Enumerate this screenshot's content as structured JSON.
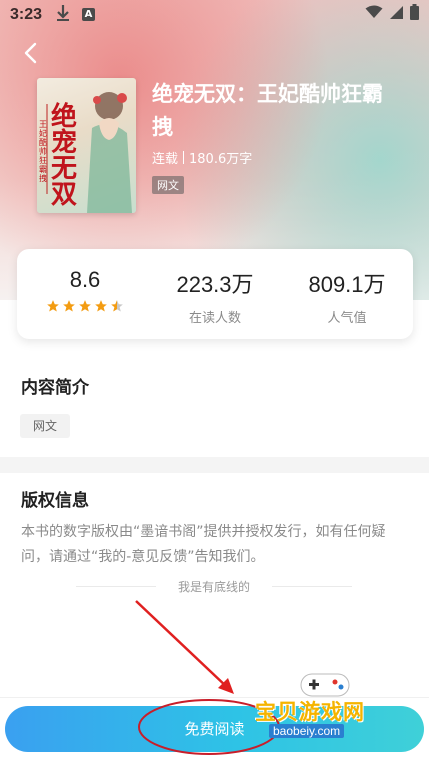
{
  "status_bar": {
    "time": "3:23",
    "left_icons": [
      "download-icon",
      "a-notification-icon"
    ],
    "right_icons": [
      "wifi-icon",
      "signal-icon",
      "battery-icon"
    ],
    "notification_letter": "A"
  },
  "header": {
    "back_icon": "chevron-left-icon"
  },
  "book": {
    "title": "绝宠无双：王妃酷帅狂霸拽",
    "status": "连载",
    "word_count": "180.6万字",
    "tag": "网文",
    "cover_text": "绝宠无双",
    "cover_subtitle": "王妃酷帅狂霸拽"
  },
  "stats": {
    "rating": "8.6",
    "rating_stars": 4.5,
    "readers_value": "223.3万",
    "readers_label": "在读人数",
    "popularity_value": "809.1万",
    "popularity_label": "人气值"
  },
  "intro": {
    "title": "内容简介",
    "tag": "网文"
  },
  "copyright": {
    "title": "版权信息",
    "text": "本书的数字版权由“墨谙书阁”提供并授权发行，如有任何疑问，请通过“我的-意见反馈”告知我们。",
    "end_text": "我是有底线的"
  },
  "bottom": {
    "read_button": "免费阅读"
  },
  "watermark": {
    "title": "宝贝游戏网",
    "url": "baobeiy.com"
  },
  "colors": {
    "button_start": "#3aa0f0",
    "button_end": "#3fd0d8",
    "star": "#f39c12",
    "annotation": "#e02020"
  }
}
